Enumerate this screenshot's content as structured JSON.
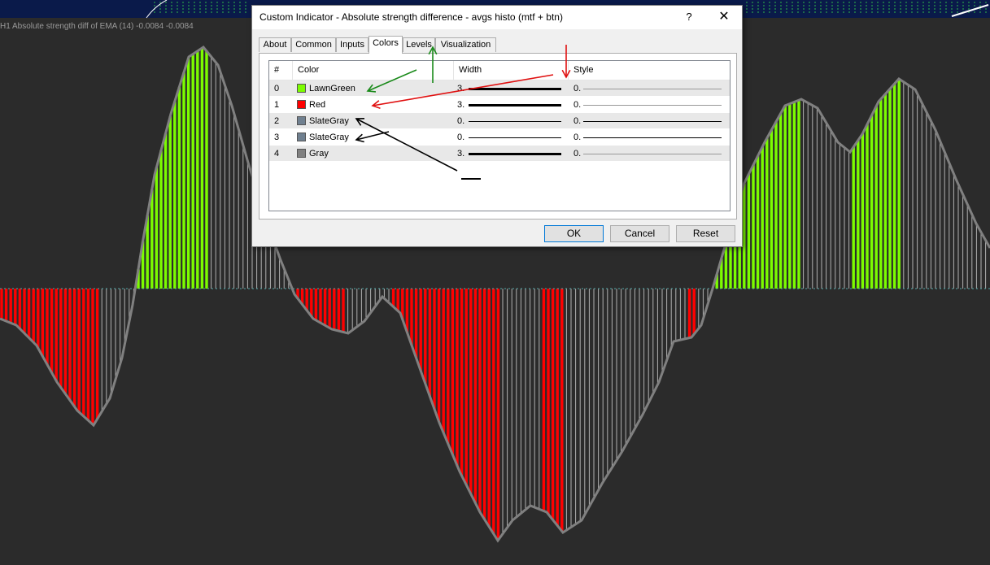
{
  "indicator_label": "H1 Absolute strength diff of EMA (14) -0.0084 -0.0084",
  "dialog": {
    "title": "Custom Indicator - Absolute strength difference - avgs histo (mtf + btn)",
    "help_label": "?",
    "close_label": "✕",
    "tabs": [
      "About",
      "Common",
      "Inputs",
      "Colors",
      "Levels",
      "Visualization"
    ],
    "active_tab": "Colors",
    "table": {
      "headers": [
        "#",
        "Color",
        "Width",
        "Style"
      ],
      "rows": [
        {
          "index": "0",
          "color_name": "LawnGreen",
          "color_hex": "#7cfc00",
          "width": "3.",
          "style": "0."
        },
        {
          "index": "1",
          "color_name": "Red",
          "color_hex": "#ff0000",
          "width": "3.",
          "style": "0."
        },
        {
          "index": "2",
          "color_name": "SlateGray",
          "color_hex": "#708090",
          "width": "0.",
          "style": "0."
        },
        {
          "index": "3",
          "color_name": "SlateGray",
          "color_hex": "#708090",
          "width": "0.",
          "style": "0."
        },
        {
          "index": "4",
          "color_name": "Gray",
          "color_hex": "#808080",
          "width": "3.",
          "style": "0."
        }
      ]
    },
    "buttons": {
      "ok": "OK",
      "cancel": "Cancel",
      "reset": "Reset"
    }
  },
  "colors": {
    "background": "#2b2b2b",
    "up": "#7cfc00",
    "down": "#ff0000",
    "neutral": "#b0b0b0",
    "outline": "#808080",
    "zero_line": "#4fa8a8",
    "annotation_green": "#1a8a1a",
    "annotation_red": "#e01010",
    "annotation_black": "#000000"
  }
}
